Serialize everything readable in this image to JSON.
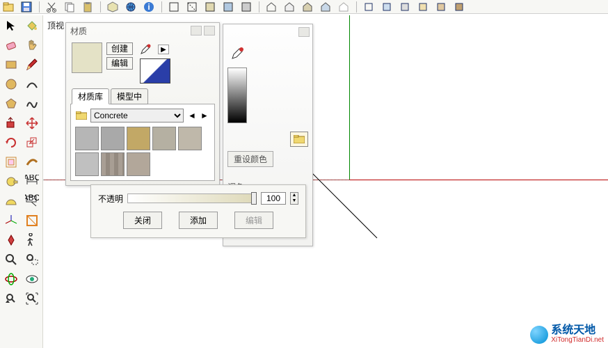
{
  "view_label": "顶视",
  "topbar_icons": [
    "file-open",
    "save",
    "cut",
    "copy",
    "paste",
    "globe",
    "box",
    "info",
    "divider",
    "box2",
    "box3",
    "box4",
    "box5",
    "cube1",
    "cube2",
    "cube3",
    "cube4",
    "cube5",
    "cube6",
    "house1",
    "house2",
    "house3",
    "house4",
    "house5",
    "divider",
    "render1",
    "render2",
    "render3",
    "render4",
    "render5",
    "render6"
  ],
  "toolbox": [
    [
      "cursor",
      "paint-bucket"
    ],
    [
      "eraser",
      "hand"
    ],
    [
      "rectangle",
      "pencil"
    ],
    [
      "circle",
      "arc"
    ],
    [
      "polygon",
      "wire"
    ],
    [
      "pushpull",
      "move-red"
    ],
    [
      "rotate-red",
      "scale-red"
    ],
    [
      "clipboard",
      "follow"
    ],
    [
      "tape",
      "axes"
    ],
    [
      "ruler",
      "text-tag"
    ],
    [
      "axis3d",
      "section"
    ],
    [
      "star",
      "walk"
    ],
    [
      "zoom",
      "zoom-win"
    ],
    [
      "orbit",
      "look"
    ],
    [
      "prev",
      "zoom-ext"
    ]
  ],
  "panel_back": {
    "reset_color": "重设颜色",
    "tint": "调色"
  },
  "materials": {
    "title": "材质",
    "create": "创建",
    "edit": "编辑",
    "tabs": {
      "library": "材质库",
      "in_model": "模型中"
    },
    "library": "Concrete",
    "swatches": [
      "#b6b6b6",
      "#a9a9a9",
      "#c2a866",
      "#b5b0a2",
      "#bfb8aa",
      "#c0c0c0",
      "#a89e94",
      "#b2a79a"
    ]
  },
  "card2": {
    "opacity_label": "不透明",
    "opacity_value": "100",
    "close": "关闭",
    "add": "添加",
    "edit": "编辑"
  },
  "watermark": {
    "line1": "系统天地",
    "line2": "XiTongTianDi.net"
  }
}
